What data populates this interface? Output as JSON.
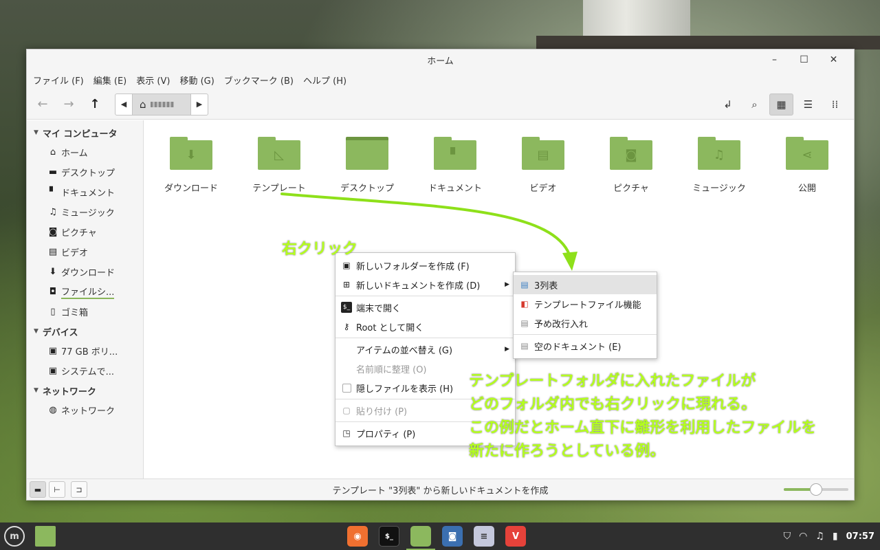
{
  "window": {
    "title": "ホーム"
  },
  "menubar": [
    "ファイル (F)",
    "編集 (E)",
    "表示 (V)",
    "移動 (G)",
    "ブックマーク (B)",
    "ヘルプ (H)"
  ],
  "sidebar": {
    "sections": [
      {
        "title": "マイ コンピュータ",
        "items": [
          {
            "label": "ホーム",
            "icon": "home-icon"
          },
          {
            "label": "デスクトップ",
            "icon": "desktop-icon"
          },
          {
            "label": "ドキュメント",
            "icon": "document-icon"
          },
          {
            "label": "ミュージック",
            "icon": "music-icon"
          },
          {
            "label": "ピクチャ",
            "icon": "camera-icon"
          },
          {
            "label": "ビデオ",
            "icon": "film-icon"
          },
          {
            "label": "ダウンロード",
            "icon": "download-icon"
          },
          {
            "label": "ファイルシ...",
            "icon": "drive-icon"
          },
          {
            "label": "ゴミ箱",
            "icon": "trash-icon"
          }
        ]
      },
      {
        "title": "デバイス",
        "items": [
          {
            "label": "77 GB ボリ...",
            "icon": "drive-icon"
          },
          {
            "label": "システムで...",
            "icon": "drive-icon"
          }
        ]
      },
      {
        "title": "ネットワーク",
        "items": [
          {
            "label": "ネットワーク",
            "icon": "network-icon"
          }
        ]
      }
    ]
  },
  "folders": [
    "ダウンロード",
    "テンプレート",
    "デスクトップ",
    "ドキュメント",
    "ビデオ",
    "ピクチャ",
    "ミュージック",
    "公開"
  ],
  "context_menu": {
    "items": [
      "新しいフォルダーを作成 (F)",
      "新しいドキュメントを作成 (D)",
      "端末で開く",
      "Root として開く",
      "アイテムの並べ替え (G)",
      "名前順に整理 (O)",
      "隠しファイルを表示 (H)",
      "貼り付け (P)",
      "プロパティ (P)"
    ]
  },
  "submenu": {
    "items": [
      "3列表",
      "テンプレートファイル機能",
      "予め改行入れ",
      "空のドキュメント (E)"
    ]
  },
  "status": {
    "text": "テンプレート \"3列表\" から新しいドキュメントを作成",
    "zoom_level": 0.5
  },
  "annotations": {
    "click_label": "右クリック",
    "note_lines": [
      "テンプレートフォルダに入れたファイルが",
      "どのフォルダ内でも右クリックに現れる。",
      "この例だとホーム直下に雛形を利用したファイルを",
      "新たに作ろうとしている例。"
    ]
  },
  "taskbar": {
    "clock": "07:57"
  },
  "colors": {
    "accent": "#8cb85e",
    "annotation": "#b4ff1e",
    "taskbar": "#2f2f2f"
  }
}
